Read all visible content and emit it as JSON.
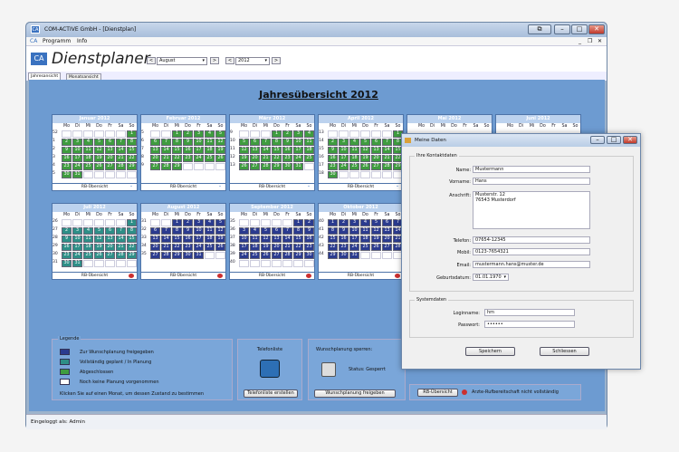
{
  "window": {
    "title": "COM-ACTIVE GmbH - [Dienstplan]",
    "logo": "CA"
  },
  "menu": {
    "items": [
      "Programm",
      "Info"
    ]
  },
  "brand": {
    "title": "Dienstplaner"
  },
  "toolbar": {
    "month": "August",
    "year": "2012"
  },
  "tabs": [
    "Jahresansicht",
    "Monatsansicht"
  ],
  "year_title": "Jahresübersicht 2012",
  "dow": [
    "Mo",
    "Di",
    "Mi",
    "Do",
    "Fr",
    "Sa",
    "So"
  ],
  "colors": {
    "blue": "#2b3b8f",
    "teal": "#2e8f87",
    "green": "#3f9c3f",
    "none": "#ffffff",
    "panel": "#6d9bd1"
  },
  "calendars": [
    {
      "name": "Januar 2012",
      "footer": "RB-Übersicht",
      "footer_icon": "chevron-down-icon",
      "weeks": [
        "52",
        "1",
        "2",
        "3",
        "4",
        "5"
      ],
      "rows": [
        [
          "",
          "",
          "",
          "",
          "",
          "",
          "1"
        ],
        [
          "2",
          "3",
          "4",
          "5",
          "6",
          "7",
          "8"
        ],
        [
          "9",
          "10",
          "11",
          "12",
          "13",
          "14",
          "15"
        ],
        [
          "16",
          "17",
          "18",
          "19",
          "20",
          "21",
          "22"
        ],
        [
          "23",
          "24",
          "25",
          "26",
          "27",
          "28",
          "29"
        ],
        [
          "30",
          "31",
          "",
          "",
          "",
          "",
          ""
        ]
      ],
      "state": "green"
    },
    {
      "name": "Februar 2012",
      "footer": "RB-Übersicht",
      "footer_icon": "chevron-down-icon",
      "weeks": [
        "5",
        "6",
        "7",
        "8",
        "9"
      ],
      "rows": [
        [
          "",
          "",
          "1",
          "2",
          "3",
          "4",
          "5"
        ],
        [
          "6",
          "7",
          "8",
          "9",
          "10",
          "11",
          "12"
        ],
        [
          "13",
          "14",
          "15",
          "16",
          "17",
          "18",
          "19"
        ],
        [
          "20",
          "21",
          "22",
          "23",
          "24",
          "25",
          "26"
        ],
        [
          "27",
          "28",
          "29",
          "",
          "",
          "",
          ""
        ]
      ],
      "state": "green"
    },
    {
      "name": "März 2012",
      "footer": "RB-Übersicht",
      "footer_icon": "chevron-down-icon",
      "weeks": [
        "9",
        "10",
        "11",
        "12",
        "13"
      ],
      "rows": [
        [
          "",
          "",
          "",
          "1",
          "2",
          "3",
          "4"
        ],
        [
          "5",
          "6",
          "7",
          "8",
          "9",
          "10",
          "11"
        ],
        [
          "12",
          "13",
          "14",
          "15",
          "16",
          "17",
          "18"
        ],
        [
          "19",
          "20",
          "21",
          "22",
          "23",
          "24",
          "25"
        ],
        [
          "26",
          "27",
          "28",
          "29",
          "30",
          "31",
          ""
        ]
      ],
      "state": "green"
    },
    {
      "name": "April 2012",
      "footer": "RB-Übersicht",
      "footer_icon": "chevron-down-icon",
      "weeks": [
        "13",
        "14",
        "15",
        "16",
        "17",
        "18"
      ],
      "rows": [
        [
          "",
          "",
          "",
          "",
          "",
          "",
          "1"
        ],
        [
          "2",
          "3",
          "4",
          "5",
          "6",
          "7",
          "8"
        ],
        [
          "9",
          "10",
          "11",
          "12",
          "13",
          "14",
          "15"
        ],
        [
          "16",
          "17",
          "18",
          "19",
          "20",
          "21",
          "22"
        ],
        [
          "23",
          "24",
          "25",
          "26",
          "27",
          "28",
          "29"
        ],
        [
          "30",
          "",
          "",
          "",
          "",
          "",
          ""
        ]
      ],
      "state": "green"
    },
    {
      "name": "Mai 2012",
      "footer": "",
      "weeks": [],
      "rows": [],
      "state": "none",
      "hidden_dow": true
    },
    {
      "name": "Juni 2012",
      "footer": "",
      "weeks": [],
      "rows": [],
      "state": "none"
    },
    {
      "name": "Juli 2012",
      "footer": "RB-Übersicht",
      "footer_icon": "no-entry-icon",
      "weeks": [
        "26",
        "27",
        "28",
        "29",
        "30",
        "31"
      ],
      "rows": [
        [
          "",
          "",
          "",
          "",
          "",
          "",
          "1"
        ],
        [
          "2",
          "3",
          "4",
          "5",
          "6",
          "7",
          "8"
        ],
        [
          "9",
          "10",
          "11",
          "12",
          "13",
          "14",
          "15"
        ],
        [
          "16",
          "17",
          "18",
          "19",
          "20",
          "21",
          "22"
        ],
        [
          "23",
          "24",
          "25",
          "26",
          "27",
          "28",
          "29"
        ],
        [
          "30",
          "31",
          "",
          "",
          "",
          "",
          ""
        ]
      ],
      "state": "teal"
    },
    {
      "name": "August 2012",
      "footer": "RB-Übersicht",
      "footer_icon": "no-entry-icon",
      "weeks": [
        "31",
        "32",
        "33",
        "34",
        "35"
      ],
      "rows": [
        [
          "",
          "",
          "1",
          "2",
          "3",
          "4",
          "5"
        ],
        [
          "6",
          "7",
          "8",
          "9",
          "10",
          "11",
          "12"
        ],
        [
          "13",
          "14",
          "15",
          "16",
          "17",
          "18",
          "19"
        ],
        [
          "20",
          "21",
          "22",
          "23",
          "24",
          "25",
          "26"
        ],
        [
          "27",
          "28",
          "29",
          "30",
          "31",
          "",
          ""
        ]
      ],
      "state": "blue"
    },
    {
      "name": "September 2012",
      "footer": "RB-Übersicht",
      "footer_icon": "no-entry-icon",
      "weeks": [
        "35",
        "36",
        "37",
        "38",
        "39",
        "40"
      ],
      "rows": [
        [
          "",
          "",
          "",
          "",
          "",
          "1",
          "2"
        ],
        [
          "3",
          "4",
          "5",
          "6",
          "7",
          "8",
          "9"
        ],
        [
          "10",
          "11",
          "12",
          "13",
          "14",
          "15",
          "16"
        ],
        [
          "17",
          "18",
          "19",
          "20",
          "21",
          "22",
          "23"
        ],
        [
          "24",
          "25",
          "26",
          "27",
          "28",
          "29",
          "30"
        ],
        [
          "",
          "",
          "",
          "",
          "",
          "",
          ""
        ]
      ],
      "state": "blue"
    },
    {
      "name": "Oktober 2012",
      "footer": "RB-Übersicht",
      "footer_icon": "no-entry-icon",
      "weeks": [
        "40",
        "41",
        "42",
        "43",
        "44"
      ],
      "rows": [
        [
          "1",
          "2",
          "3",
          "4",
          "5",
          "6",
          "7"
        ],
        [
          "8",
          "9",
          "10",
          "11",
          "12",
          "13",
          "14"
        ],
        [
          "15",
          "16",
          "17",
          "18",
          "19",
          "20",
          "21"
        ],
        [
          "22",
          "23",
          "24",
          "25",
          "26",
          "27",
          "28"
        ],
        [
          "29",
          "30",
          "31",
          "",
          "",
          "",
          ""
        ]
      ],
      "state": "blue"
    }
  ],
  "legend": {
    "title": "Legende",
    "items": [
      "Zur Wunschplanung freigegeben",
      "Vollständig geplant / In Planung",
      "Abgeschlossen",
      "Noch keine Planung vorgenommen"
    ],
    "note": "Klicken Sie auf einen Monat, um dessen Zustand zu bestimmen"
  },
  "phone": {
    "title": "Telefonliste",
    "button": "Telefonliste erstellen"
  },
  "lock": {
    "title": "Wunschplanung sperren:",
    "status": "Status: Gesperrt",
    "button": "Wunschplanung freigeben"
  },
  "rb_box": {
    "label": "RB-Übersicht",
    "note": "Arzte-Rufbereitschaft nicht vollständig"
  },
  "status_bar": "Eingeloggt als: Admin",
  "dialog": {
    "title": "Meine Daten",
    "contact_group": "Ihre Kontaktdaten",
    "fields": [
      {
        "label": "Name:",
        "value": "Mustermann"
      },
      {
        "label": "Vorname:",
        "value": "Hans"
      },
      {
        "label": "Anschrift:",
        "value": "Musterstr. 12",
        "value2": "76543 Musterdorf"
      },
      {
        "label": "Telefon:",
        "value": "07654-12345"
      },
      {
        "label": "Mobil:",
        "value": "0123-7654321"
      },
      {
        "label": "Email:",
        "value": "mustermann.hans@muster.de"
      },
      {
        "label": "Geburtsdatum:",
        "value": "01.01.1970"
      }
    ],
    "system_group": "Systemdaten",
    "login_label": "Loginname:",
    "login_value": "hm",
    "password_label": "Passwort:",
    "password_value": "••••••",
    "save": "Speichern",
    "close": "Schliessen"
  }
}
